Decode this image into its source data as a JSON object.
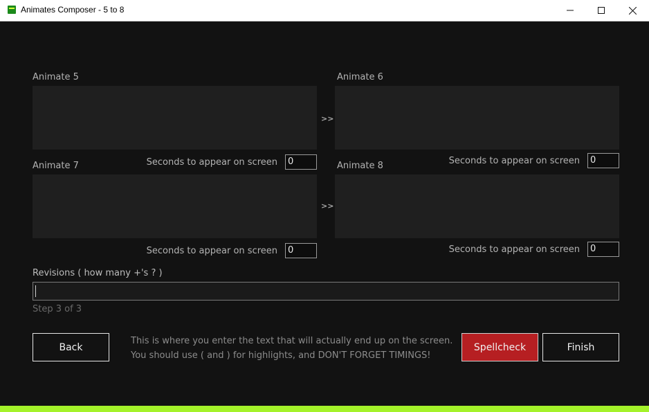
{
  "window": {
    "title": "Animates Composer - 5 to 8",
    "minimize_glyph": "—",
    "maximize_glyph": "☐",
    "close_glyph": "✕"
  },
  "animates": [
    {
      "label": "Animate 5",
      "seconds_label": "Seconds to appear on screen",
      "seconds_value": "0"
    },
    {
      "label": "Animate 6",
      "seconds_label": "Seconds to appear on screen",
      "seconds_value": "0"
    },
    {
      "label": "Animate 7",
      "seconds_label": "Seconds to appear on screen",
      "seconds_value": "0"
    },
    {
      "label": "Animate 8",
      "seconds_label": "Seconds to appear on screen",
      "seconds_value": "0"
    }
  ],
  "arrows": [
    ">>",
    ">>"
  ],
  "revisions": {
    "label": "Revisions ( how many +'s ? )",
    "value": ""
  },
  "step": "Step 3 of 3",
  "hint": {
    "line1": "This is where you enter the text that will actually end up on the screen.",
    "line2": "You should use ( and ) for highlights, and DON'T FORGET TIMINGS!"
  },
  "buttons": {
    "back": "Back",
    "spellcheck": "Spellcheck",
    "finish": "Finish"
  },
  "colors": {
    "accent_red": "#b61f22",
    "bottom_bar": "#a4f22a",
    "background": "#121212"
  }
}
